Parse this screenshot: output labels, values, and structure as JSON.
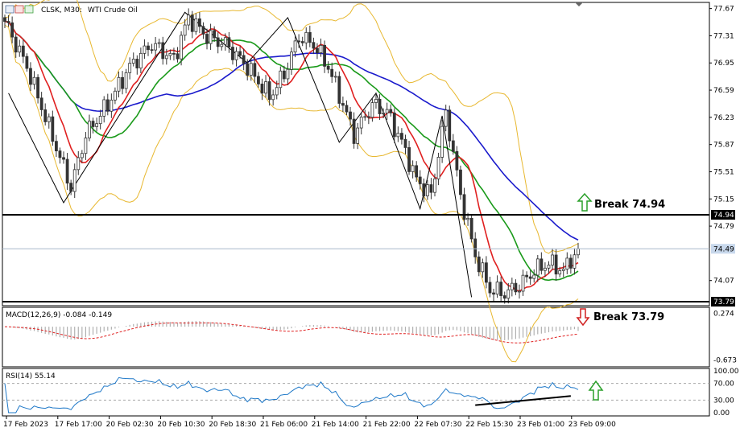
{
  "header": {
    "symbol": "CLSK, M30:",
    "name": "WTI Crude Oil"
  },
  "indicators": {
    "macd_label": "MACD(12,26,9) -0.084 -0.149",
    "rsi_label": "RSI(14) 55.14"
  },
  "annotations": {
    "break_up": "Break 74.94",
    "break_down": "Break 73.79"
  },
  "colors": {
    "candle_up": "#4a4a4a",
    "candle_down": "#4a4a4a",
    "sma_fast": "#e02020",
    "sma_mid": "#1a9a1a",
    "sma_slow": "#1a1acc",
    "bollinger": "#e8b830",
    "macd_hist": "#b0b0b0",
    "macd_signal": "#e02020",
    "rsi_line": "#1e78c8",
    "arrow_up": "#2aa02a",
    "arrow_down": "#d02020"
  },
  "chart_data": {
    "type": "candlestick",
    "price_axis": {
      "ticks": [
        77.67,
        77.31,
        76.95,
        76.59,
        76.23,
        75.87,
        75.51,
        75.15,
        74.79,
        74.07
      ],
      "ylim": [
        73.79,
        77.73
      ]
    },
    "levels": [
      {
        "value": 74.94,
        "label": "74.94"
      },
      {
        "value": 73.79,
        "label": "73.79"
      }
    ],
    "current_price": {
      "value": 74.49,
      "label": "74.49"
    },
    "time_labels": [
      "17 Feb 2023",
      "17 Feb 17:00",
      "20 Feb 02:30",
      "20 Feb 10:30",
      "20 Feb 18:30",
      "21 Feb 06:00",
      "21 Feb 14:00",
      "21 Feb 22:00",
      "22 Feb 07:30",
      "22 Feb 15:30",
      "23 Feb 01:00",
      "23 Feb 09:00"
    ],
    "close_keypoints": [
      [
        0,
        77.5
      ],
      [
        6,
        76.9
      ],
      [
        12,
        76.1
      ],
      [
        18,
        75.3
      ],
      [
        22,
        76.0
      ],
      [
        28,
        76.4
      ],
      [
        34,
        76.9
      ],
      [
        40,
        77.2
      ],
      [
        46,
        77.0
      ],
      [
        50,
        77.55
      ],
      [
        55,
        77.3
      ],
      [
        60,
        77.2
      ],
      [
        66,
        76.9
      ],
      [
        72,
        76.5
      ],
      [
        76,
        76.8
      ],
      [
        80,
        77.3
      ],
      [
        84,
        77.2
      ],
      [
        88,
        76.9
      ],
      [
        92,
        76.4
      ],
      [
        95,
        76.0
      ],
      [
        100,
        76.4
      ],
      [
        104,
        76.3
      ],
      [
        108,
        75.9
      ],
      [
        112,
        75.4
      ],
      [
        116,
        75.2
      ],
      [
        120,
        76.3
      ],
      [
        124,
        75.2
      ],
      [
        128,
        74.4
      ],
      [
        132,
        73.95
      ],
      [
        136,
        73.9
      ],
      [
        140,
        74.0
      ],
      [
        144,
        74.2
      ],
      [
        148,
        74.3
      ],
      [
        152,
        74.2
      ],
      [
        156,
        74.49
      ]
    ],
    "zigzag": [
      [
        1,
        76.55
      ],
      [
        16,
        75.1
      ],
      [
        49,
        77.62
      ],
      [
        66,
        76.95
      ],
      [
        77,
        77.55
      ],
      [
        91,
        75.9
      ],
      [
        101,
        76.55
      ],
      [
        113,
        75.02
      ],
      [
        119,
        76.25
      ],
      [
        127,
        73.85
      ]
    ],
    "macd": {
      "label": "MACD(12,26,9)",
      "macd_value": -0.084,
      "signal_value": -0.149,
      "ticks": [
        0.274,
        -0.673
      ],
      "ylim": [
        -0.78,
        0.36
      ]
    },
    "rsi": {
      "label": "RSI(14)",
      "value": 55.14,
      "ticks": [
        100.0,
        70.0,
        30.0,
        0.0
      ],
      "tick_labels": [
        "100.00",
        "70.00",
        "30.00",
        "0.00"
      ],
      "levels": [
        70,
        30
      ],
      "ylim": [
        0,
        100
      ]
    }
  }
}
